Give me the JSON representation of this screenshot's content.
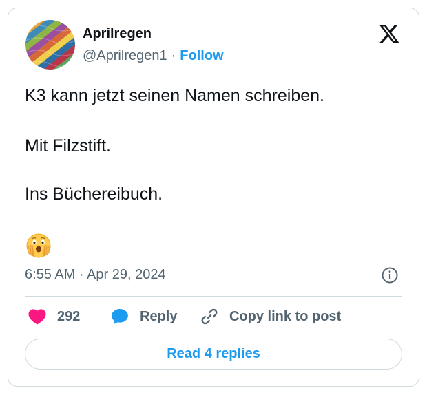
{
  "author": {
    "display_name": "Aprilregen",
    "handle": "@Aprilregen1",
    "separator": "·",
    "follow_label": "Follow"
  },
  "tweet": {
    "lines": [
      "K3 kann jetzt seinen Namen schreiben.",
      "Mit Filzstift.",
      "Ins Büchereibuch."
    ],
    "emoji": "face-with-open-eyes-and-hand-over-mouth-emoji",
    "timestamp": "6:55 AM · Apr 29, 2024"
  },
  "actions": {
    "like_count": "292",
    "reply_label": "Reply",
    "copy_label": "Copy link to post"
  },
  "read_replies_label": "Read 4 replies",
  "icons": {
    "logo": "x-logo-icon",
    "info": "info-icon",
    "like": "heart-icon",
    "reply": "speech-bubble-icon",
    "copy": "link-icon"
  },
  "colors": {
    "accent": "#1d9bf0",
    "text_primary": "#0f1419",
    "text_secondary": "#536471",
    "like": "#f91880",
    "border": "#cfd9de"
  }
}
